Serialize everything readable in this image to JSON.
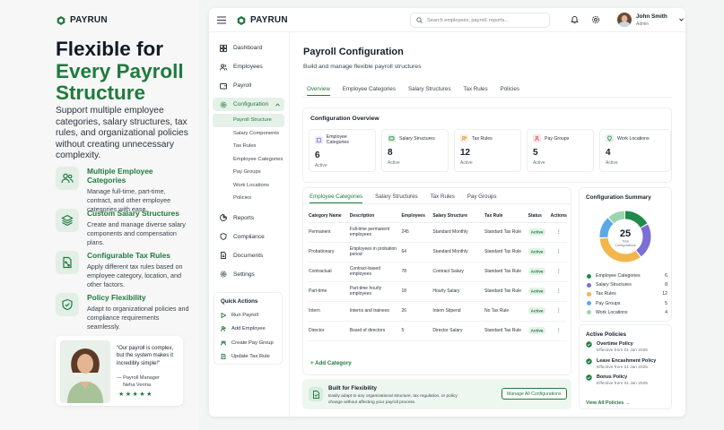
{
  "brand": {
    "name": "PAYRUN"
  },
  "marketing": {
    "heading_line1": "Flexible for",
    "heading_line2": "Every Payroll",
    "heading_line3": "Structure",
    "lead": "Support multiple employee categories, salary structures, tax rules, and organizational policies without creating unnecessary complexity.",
    "features": [
      {
        "title": "Multiple Employee Categories",
        "desc": "Manage full-time, part-time, contract, and other employee categories with ease.",
        "icon": "users-icon"
      },
      {
        "title": "Custom Salary Structures",
        "desc": "Create and manage diverse salary components and compensation plans.",
        "icon": "layers-icon"
      },
      {
        "title": "Configurable Tax Rules",
        "desc": "Apply different tax rules based on employee category, location, and other factors.",
        "icon": "tax-document-icon"
      },
      {
        "title": "Policy Flexibility",
        "desc": "Adapt to organizational policies and compliance requirements seamlessly.",
        "icon": "shield-check-icon"
      }
    ],
    "testimonial": {
      "quote": "\"Our payroll is complex, but the system makes it incredibly simple!\"",
      "author": "— Payroll Manager",
      "name": "Neha Verma",
      "stars": "★★★★★"
    }
  },
  "header": {
    "search_placeholder": "Search employees, payroll, reports...",
    "user_name": "John Smith",
    "user_role": "Admin"
  },
  "sidebar": {
    "items": [
      {
        "label": "Dashboard",
        "icon": "grid-icon"
      },
      {
        "label": "Employees",
        "icon": "users-icon"
      },
      {
        "label": "Payroll",
        "icon": "wallet-icon"
      },
      {
        "label": "Configuration",
        "icon": "gear-icon"
      }
    ],
    "config_sub": [
      "Payroll Structure",
      "Salary Components",
      "Tax Rules",
      "Employee Categories",
      "Pay Groups",
      "Work Locations",
      "Policies"
    ],
    "items2": [
      {
        "label": "Reports",
        "icon": "reports-icon"
      },
      {
        "label": "Compliance",
        "icon": "shield-icon"
      },
      {
        "label": "Documents",
        "icon": "document-icon"
      },
      {
        "label": "Settings",
        "icon": "settings-icon"
      }
    ],
    "quick_actions_title": "Quick Actions",
    "quick_actions": [
      "Run Payroll",
      "Add Employee",
      "Create Pay Group",
      "Update Tax Rule"
    ]
  },
  "main": {
    "title": "Payroll Configuration",
    "subtitle": "Build and manage flexible payroll structures",
    "tabs": [
      "Overview",
      "Employee Categories",
      "Salary Structures",
      "Tax Rules",
      "Policies"
    ],
    "overview_title": "Configuration Overview",
    "overview": [
      {
        "label": "Employee Categories",
        "value": "6",
        "status": "Active",
        "icon": "categories-icon"
      },
      {
        "label": "Salary Structures",
        "value": "8",
        "status": "Active",
        "icon": "salary-icon"
      },
      {
        "label": "Tax Rules",
        "value": "12",
        "status": "Active",
        "icon": "tax-icon"
      },
      {
        "label": "Pay Groups",
        "value": "5",
        "status": "Active",
        "icon": "group-icon"
      },
      {
        "label": "Work Locations",
        "value": "4",
        "status": "Active",
        "icon": "location-icon"
      }
    ],
    "table_tabs": [
      "Employee Categories",
      "Salary Structures",
      "Tax Rules",
      "Pay Groups"
    ],
    "columns": [
      "Category Name",
      "Description",
      "Employees",
      "Salary Structure",
      "Tax Rule",
      "Status",
      "Actions"
    ],
    "rows": [
      [
        "Permanent",
        "Full-time permanent employees",
        "245",
        "Standard Monthly",
        "Standard Tax Rule",
        "Active"
      ],
      [
        "Probationary",
        "Employees in probation period",
        "64",
        "Standard Monthly",
        "Standard Tax Rule",
        "Active"
      ],
      [
        "Contractual",
        "Contract-based employees",
        "78",
        "Contract Salary",
        "Standard Tax Rule",
        "Active"
      ],
      [
        "Part-time",
        "Part-time hourly employees",
        "18",
        "Hourly Salary",
        "Standard Tax Rule",
        "Active"
      ],
      [
        "Intern",
        "Interns and trainees",
        "26",
        "Intern Stipend",
        "No Tax Rule",
        "Active"
      ],
      [
        "Director",
        "Board of directors",
        "5",
        "Director Salary",
        "Standard Tax Rule",
        "Active"
      ]
    ],
    "add_category": "+ Add Category",
    "banner": {
      "title": "Built for Flexibility",
      "desc": "Easily adapt to any organizational structure, tax regulation, or policy change without affecting your payroll process.",
      "button": "Manage All Configurations"
    }
  },
  "summary": {
    "title": "Configuration Summary",
    "total": "25",
    "total_label": "Total Configurations",
    "items": [
      {
        "label": "Employee Categories",
        "value": 6,
        "color": "#1f8a4c"
      },
      {
        "label": "Salary Structures",
        "value": 8,
        "color": "#7b6fd6"
      },
      {
        "label": "Tax Rules",
        "value": 12,
        "color": "#f2b64b"
      },
      {
        "label": "Pay Groups",
        "value": 5,
        "color": "#5aa9e6"
      },
      {
        "label": "Work Locations",
        "value": 4,
        "color": "#9bd5b0"
      }
    ]
  },
  "policies": {
    "title": "Active Policies",
    "items": [
      {
        "name": "Overtime Policy",
        "date": "Effective from 01 Jan 2025"
      },
      {
        "name": "Leave Encashment Policy",
        "date": "Effective from 01 Jan 2025"
      },
      {
        "name": "Bonus Policy",
        "date": "Effective from 01 Jan 2025"
      }
    ],
    "view_all": "View All Policies →"
  }
}
